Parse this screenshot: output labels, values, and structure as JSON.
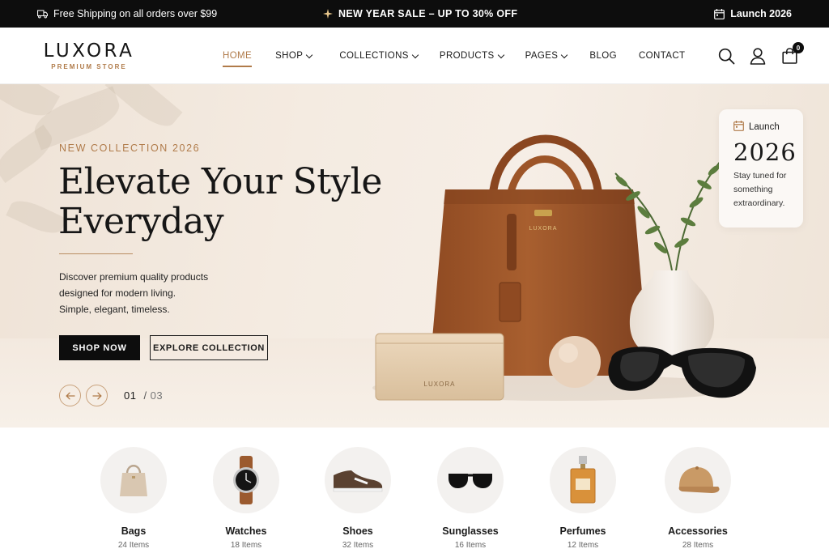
{
  "topbar": {
    "shipping": "Free Shipping on all orders over $99",
    "sale": "NEW YEAR SALE – UP TO 30% OFF",
    "launch": "Launch 2026",
    "icons": [
      "truck-icon",
      "sparkle-icon",
      "calendar-icon"
    ]
  },
  "header": {
    "logo_name": "LUXORA",
    "logo_tagline": "PREMIUM STORE",
    "nav": [
      {
        "label": "HOME",
        "active": true,
        "dropdown": false
      },
      {
        "label": "SHOP",
        "active": false,
        "dropdown": true
      },
      {
        "label": "COLLECTIONS",
        "active": false,
        "dropdown": true
      },
      {
        "label": "PRODUCTS",
        "active": false,
        "dropdown": true
      },
      {
        "label": "PAGES",
        "active": false,
        "dropdown": true
      },
      {
        "label": "BLOG",
        "active": false,
        "dropdown": false
      },
      {
        "label": "CONTACT",
        "active": false,
        "dropdown": false
      }
    ],
    "icons": [
      "search-icon",
      "user-icon",
      "shopping-bag-icon"
    ],
    "cart_count": "0"
  },
  "hero": {
    "eyebrow": "NEW COLLECTION 2026",
    "headline_line1": "Elevate Your Style",
    "headline_line2": "Everyday",
    "desc_line1": "Discover premium quality products",
    "desc_line2": "designed for modern living.",
    "desc_line3": "Simple, elegant, timeless.",
    "primary_button": "SHOP NOW",
    "secondary_button": "EXPLORE COLLECTION",
    "slide_current": "01",
    "slide_separator": "/",
    "slide_total": "03",
    "product_brand": "LUXORA"
  },
  "launch_card": {
    "label": "Launch",
    "year": "2026",
    "text_line1": "Stay tuned for",
    "text_line2": "something",
    "text_line3": "extraordinary."
  },
  "categories": [
    {
      "name": "Bags",
      "count": "24 Items",
      "icon": "bag-icon"
    },
    {
      "name": "Watches",
      "count": "18 Items",
      "icon": "watch-icon"
    },
    {
      "name": "Shoes",
      "count": "32 Items",
      "icon": "shoe-icon"
    },
    {
      "name": "Sunglasses",
      "count": "16 Items",
      "icon": "sunglasses-icon"
    },
    {
      "name": "Perfumes",
      "count": "12 Items",
      "icon": "perfume-icon"
    },
    {
      "name": "Accessories",
      "count": "28 Items",
      "icon": "cap-icon"
    }
  ],
  "colors": {
    "accent": "#b07b4a",
    "dark": "#0d0d0d",
    "hero_bg": "#f4ebe1",
    "leather": "#a0582a"
  }
}
